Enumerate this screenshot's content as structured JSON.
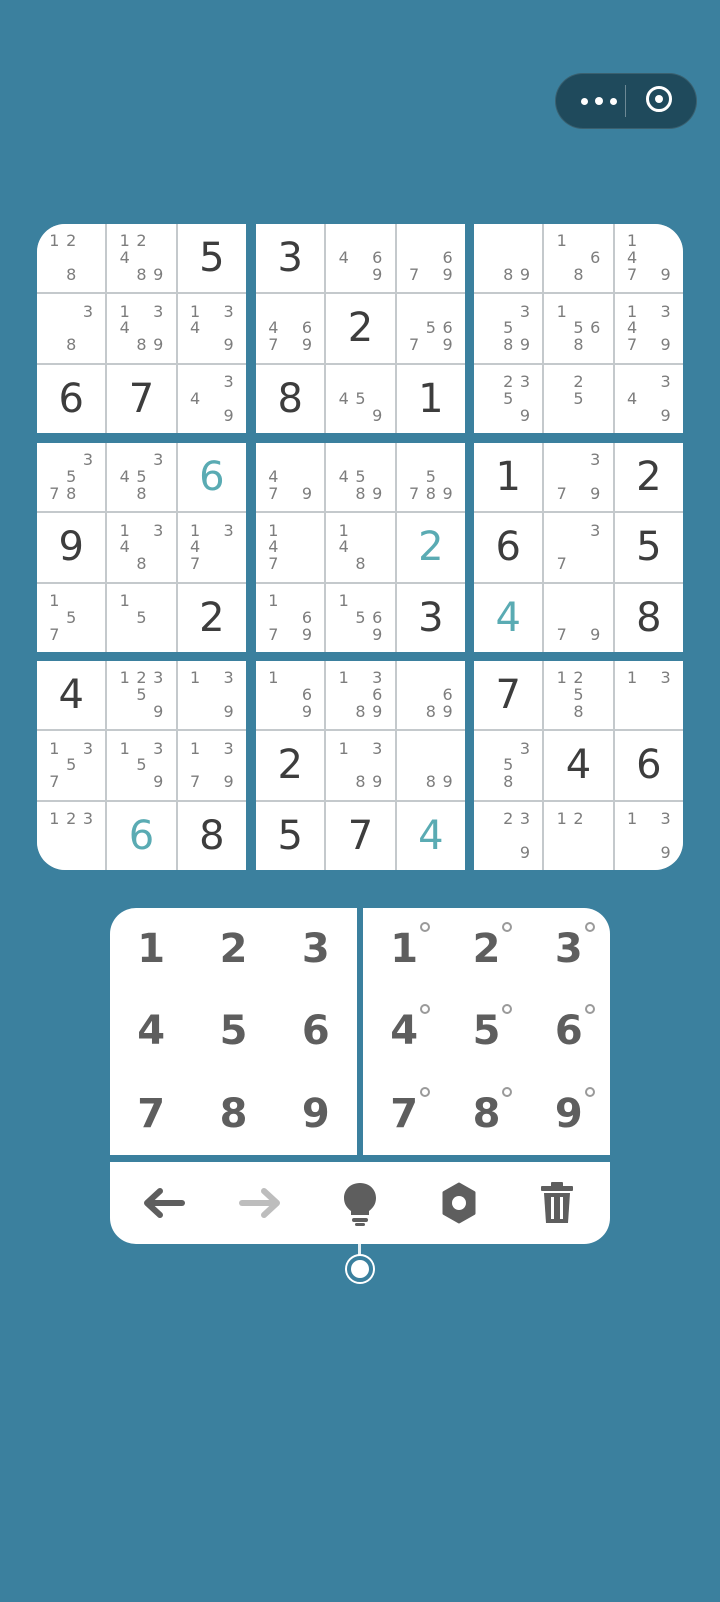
{
  "capsule": {
    "menu_icon": "more-dots-icon",
    "close_icon": "target-icon"
  },
  "board": {
    "blocks": [
      [
        {
          "notes": [
            "1",
            "2",
            "",
            "",
            "",
            "",
            "",
            "8",
            ""
          ]
        },
        {
          "notes": [
            "1",
            "2",
            "",
            "4",
            "",
            "",
            "",
            "8",
            "9"
          ]
        },
        {
          "value": "5"
        },
        {
          "notes": [
            "",
            "",
            "3",
            "",
            "",
            "",
            "",
            "8",
            ""
          ]
        },
        {
          "notes": [
            "1",
            "",
            "3",
            "4",
            "",
            "",
            "",
            "8",
            "9"
          ]
        },
        {
          "notes": [
            "1",
            "",
            "3",
            "4",
            "",
            "",
            "",
            "",
            "9"
          ]
        },
        {
          "value": "6"
        },
        {
          "value": "7"
        },
        {
          "notes": [
            "",
            "",
            "3",
            "4",
            "",
            "",
            "",
            "",
            "9"
          ]
        }
      ],
      [
        {
          "value": "3"
        },
        {
          "notes": [
            "",
            "",
            "",
            "4",
            "",
            "6",
            "",
            "",
            "9"
          ]
        },
        {
          "notes": [
            "",
            "",
            "",
            "",
            "",
            "6",
            "7",
            "",
            "9"
          ]
        },
        {
          "notes": [
            "",
            "",
            "",
            "4",
            "",
            "6",
            "7",
            "",
            "9"
          ]
        },
        {
          "value": "2"
        },
        {
          "notes": [
            "",
            "",
            "",
            "",
            "5",
            "6",
            "7",
            "",
            "9"
          ]
        },
        {
          "value": "8"
        },
        {
          "notes": [
            "",
            "",
            "",
            "4",
            "5",
            "",
            "",
            "",
            "9"
          ]
        },
        {
          "value": "1"
        }
      ],
      [
        {
          "notes": [
            "",
            "",
            "",
            "",
            "",
            "",
            "",
            "8",
            "9"
          ]
        },
        {
          "notes": [
            "1",
            "",
            "",
            "",
            "",
            "6",
            "",
            "8",
            ""
          ]
        },
        {
          "notes": [
            "1",
            "",
            "",
            "4",
            "",
            "",
            "7",
            "",
            "9"
          ]
        },
        {
          "notes": [
            "",
            "",
            "3",
            "",
            "5",
            "",
            "",
            "8",
            "9"
          ]
        },
        {
          "notes": [
            "1",
            "",
            "",
            "",
            "5",
            "6",
            "",
            "8",
            ""
          ]
        },
        {
          "notes": [
            "1",
            "",
            "3",
            "4",
            "",
            "",
            "7",
            "",
            "9"
          ]
        },
        {
          "notes": [
            "",
            "2",
            "3",
            "",
            "5",
            "",
            "",
            "",
            "9"
          ]
        },
        {
          "notes": [
            "",
            "2",
            "",
            "",
            "5",
            "",
            "",
            "",
            ""
          ]
        },
        {
          "notes": [
            "",
            "",
            "3",
            "4",
            "",
            "",
            "",
            "",
            "9"
          ]
        }
      ],
      [
        {
          "notes": [
            "",
            "",
            "3",
            "",
            "5",
            "",
            "7",
            "8",
            ""
          ]
        },
        {
          "notes": [
            "",
            "",
            "3",
            "4",
            "5",
            "",
            "",
            "8",
            ""
          ]
        },
        {
          "value": "6",
          "user": true
        },
        {
          "value": "9"
        },
        {
          "notes": [
            "1",
            "",
            "3",
            "4",
            "",
            "",
            "",
            "8",
            ""
          ]
        },
        {
          "notes": [
            "1",
            "",
            "3",
            "4",
            "",
            "",
            "7",
            "",
            ""
          ]
        },
        {
          "notes": [
            "1",
            "",
            "",
            "",
            "5",
            "",
            "7",
            "",
            ""
          ]
        },
        {
          "notes": [
            "1",
            "",
            "",
            "",
            "5",
            "",
            "",
            "",
            ""
          ]
        },
        {
          "value": "2"
        }
      ],
      [
        {
          "notes": [
            "",
            "",
            "",
            "4",
            "",
            "",
            "7",
            "",
            "9"
          ]
        },
        {
          "notes": [
            "",
            "",
            "",
            "4",
            "5",
            "",
            "",
            "8",
            "9"
          ]
        },
        {
          "notes": [
            "",
            "",
            "",
            "",
            "5",
            "",
            "7",
            "8",
            "9"
          ]
        },
        {
          "notes": [
            "1",
            "",
            "",
            "4",
            "",
            "",
            "7",
            "",
            ""
          ]
        },
        {
          "notes": [
            "1",
            "",
            "",
            "4",
            "",
            "",
            "",
            "8",
            ""
          ]
        },
        {
          "value": "2",
          "user": true
        },
        {
          "notes": [
            "1",
            "",
            "",
            "",
            "",
            "6",
            "7",
            "",
            "9"
          ]
        },
        {
          "notes": [
            "1",
            "",
            "",
            "",
            "5",
            "6",
            "",
            "",
            "9"
          ]
        },
        {
          "value": "3"
        }
      ],
      [
        {
          "value": "1"
        },
        {
          "notes": [
            "",
            "",
            "3",
            "",
            "",
            "",
            "7",
            "",
            "9"
          ]
        },
        {
          "value": "2"
        },
        {
          "value": "6"
        },
        {
          "notes": [
            "",
            "",
            "3",
            "",
            "",
            "",
            "7",
            "",
            ""
          ]
        },
        {
          "value": "5"
        },
        {
          "value": "4",
          "user": true
        },
        {
          "notes": [
            "",
            "",
            "",
            "",
            "",
            "",
            "7",
            "",
            "9"
          ]
        },
        {
          "value": "8"
        }
      ],
      [
        {
          "value": "4"
        },
        {
          "notes": [
            "1",
            "2",
            "3",
            "",
            "5",
            "",
            "",
            "",
            "9"
          ]
        },
        {
          "notes": [
            "1",
            "",
            "3",
            "",
            "",
            "",
            "",
            "",
            "9"
          ]
        },
        {
          "notes": [
            "1",
            "",
            "3",
            "",
            "5",
            "",
            "7",
            "",
            ""
          ]
        },
        {
          "notes": [
            "1",
            "",
            "3",
            "",
            "5",
            "",
            "",
            "",
            "9"
          ]
        },
        {
          "notes": [
            "1",
            "",
            "3",
            "",
            "",
            "",
            "7",
            "",
            "9"
          ]
        },
        {
          "notes": [
            "1",
            "2",
            "3",
            "",
            "",
            "",
            "",
            "",
            ""
          ]
        },
        {
          "value": "6",
          "user": true
        },
        {
          "value": "8"
        }
      ],
      [
        {
          "notes": [
            "1",
            "",
            "",
            "",
            "",
            "6",
            "",
            "",
            "9"
          ]
        },
        {
          "notes": [
            "1",
            "",
            "3",
            "",
            "",
            "6",
            "",
            "8",
            "9"
          ]
        },
        {
          "notes": [
            "",
            "",
            "",
            "",
            "",
            "6",
            "",
            "8",
            "9"
          ]
        },
        {
          "value": "2"
        },
        {
          "notes": [
            "1",
            "",
            "3",
            "",
            "",
            "",
            "",
            "8",
            "9"
          ]
        },
        {
          "notes": [
            "",
            "",
            "",
            "",
            "",
            "",
            "",
            "8",
            "9"
          ]
        },
        {
          "value": "5"
        },
        {
          "value": "7"
        },
        {
          "value": "4",
          "user": true
        }
      ],
      [
        {
          "value": "7"
        },
        {
          "notes": [
            "1",
            "2",
            "",
            "",
            "5",
            "",
            "",
            "8",
            ""
          ]
        },
        {
          "notes": [
            "1",
            "",
            "3",
            "",
            "",
            "",
            "",
            "",
            ""
          ]
        },
        {
          "notes": [
            "",
            "",
            "3",
            "",
            "5",
            "",
            "",
            "8",
            ""
          ]
        },
        {
          "value": "4"
        },
        {
          "value": "6"
        },
        {
          "notes": [
            "",
            "2",
            "3",
            "",
            "",
            "",
            "",
            "",
            "9"
          ]
        },
        {
          "notes": [
            "1",
            "2",
            "",
            "",
            "",
            "",
            "",
            "",
            ""
          ]
        },
        {
          "notes": [
            "1",
            "",
            "3",
            "",
            "",
            "",
            "",
            "",
            "9"
          ]
        }
      ]
    ]
  },
  "keypad": {
    "numbers": [
      "1",
      "2",
      "3",
      "4",
      "5",
      "6",
      "7",
      "8",
      "9"
    ],
    "note_numbers": [
      "1",
      "2",
      "3",
      "4",
      "5",
      "6",
      "7",
      "8",
      "9"
    ]
  },
  "toolbar": {
    "icons": [
      "undo-arrow-icon",
      "redo-arrow-icon",
      "hint-bulb-icon",
      "settings-gear-icon",
      "trash-icon"
    ]
  }
}
